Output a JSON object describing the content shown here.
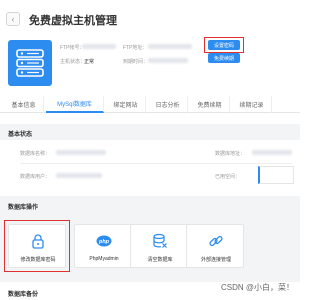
{
  "header": {
    "title": "免费虚拟主机管理",
    "back_icon": "chevron-left-icon"
  },
  "host_info": {
    "ftp_account_label": "FTP帐号：",
    "ftp_address_label": "FTP地址：",
    "host_status_label": "主机状态：",
    "host_status_value": "正常",
    "expire_label": "到期时间：",
    "reset_password_button": "设置密码",
    "free_renew_button": "免费续期"
  },
  "tabs": [
    {
      "label": "基本信息",
      "active": false
    },
    {
      "label": "MySql数据库",
      "active": true
    },
    {
      "label": "绑定网站",
      "active": false
    },
    {
      "label": "日志分析",
      "active": false
    },
    {
      "label": "免费续期",
      "active": false
    },
    {
      "label": "续期记录",
      "active": false
    }
  ],
  "basic_status": {
    "title": "基本状态",
    "db_name_label": "数据库名称：",
    "db_address_label": "数据库地址：",
    "db_user_label": "数据库用户：",
    "db_size_label": "已用空间："
  },
  "db_operations": {
    "title": "数据库操作",
    "items": [
      {
        "label": "修改数据库密码",
        "icon": "lock-icon"
      },
      {
        "label": "PhpMyadmin",
        "icon": "php-icon"
      },
      {
        "label": "清空数据库",
        "icon": "database-clear-icon"
      },
      {
        "label": "外部连接管理",
        "icon": "link-icon"
      }
    ]
  },
  "footer": {
    "title": "数据库备份"
  },
  "watermark": "CSDN @小白，菜！",
  "colors": {
    "accent": "#2d8cf0",
    "highlight": "#e03131"
  }
}
